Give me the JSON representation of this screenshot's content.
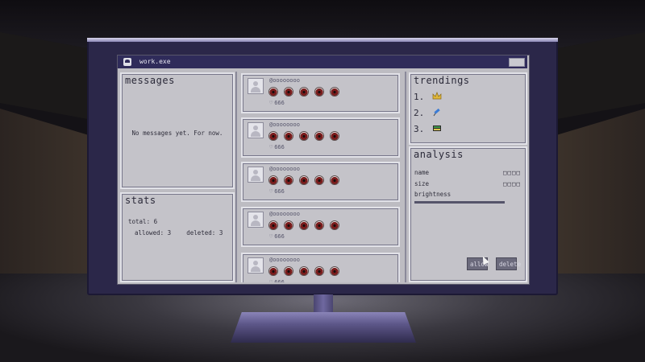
{
  "window": {
    "title": "work.exe"
  },
  "messages": {
    "title": "messages",
    "empty_text": "No messages yet. For now."
  },
  "stats": {
    "title": "stats",
    "total": "total: 6",
    "allowed": "allowed: 3",
    "deleted": "deleted: 3"
  },
  "feed": {
    "posts": [
      {
        "handle": "@oooooooo",
        "likes": "666",
        "eyes": 5
      },
      {
        "handle": "@oooooooo",
        "likes": "666",
        "eyes": 5
      },
      {
        "handle": "@oooooooo",
        "likes": "666",
        "eyes": 5
      },
      {
        "handle": "@oooooooo",
        "likes": "666",
        "eyes": 5
      },
      {
        "handle": "@oooooooo",
        "likes": "666",
        "eyes": 5
      }
    ]
  },
  "trendings": {
    "title": "trendings",
    "items": [
      {
        "rank": "1.",
        "icon": "crown-icon"
      },
      {
        "rank": "2.",
        "icon": "syringe-icon"
      },
      {
        "rank": "3.",
        "icon": "book-icon"
      }
    ]
  },
  "analysis": {
    "title": "analysis",
    "name_label": "name",
    "name_value": "□□□□",
    "size_label": "size",
    "size_value": "□□□□",
    "brightness_label": "brightness",
    "allow_label": "allow",
    "delete_label": "delete"
  }
}
